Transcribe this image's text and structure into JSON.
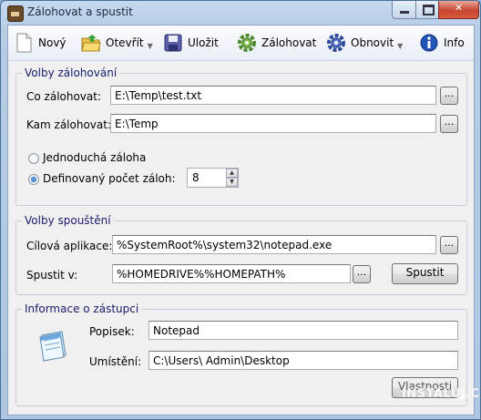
{
  "window": {
    "title": "Zálohovat a spustit"
  },
  "toolbar": {
    "new_label": "Nový",
    "open_label": "Otevřít",
    "save_label": "Uložit",
    "backup_label": "Zálohovat",
    "restore_label": "Obnovit",
    "info_label": "Info"
  },
  "backup_options": {
    "legend": "Volby zálohování",
    "source_label": "Co zálohovat:",
    "source_value": "E:\\Temp\\test.txt",
    "dest_label": "Kam zálohovat:",
    "dest_value": "E:\\Temp",
    "simple_label": "Jednoduchá záloha",
    "defined_label": "Definovaný počet záloh:",
    "count_value": "8",
    "browse_label": "..."
  },
  "launch_options": {
    "legend": "Volby spouštění",
    "target_label": "Cílová aplikace:",
    "target_value": "%SystemRoot%\\system32\\notepad.exe",
    "startin_label": "Spustit v:",
    "startin_value": "%HOMEDRIVE%%HOMEPATH%",
    "run_label": "Spustit",
    "browse_label": "..."
  },
  "shortcut_info": {
    "legend": "Informace o zástupci",
    "description_label": "Popisek:",
    "description_value": "Notepad",
    "location_label": "Umístění:",
    "location_value": "C:\\Users\\ Admin\\Desktop",
    "properties_label": "Vlastnosti"
  },
  "watermark": "INSTALUJ.CZ"
}
